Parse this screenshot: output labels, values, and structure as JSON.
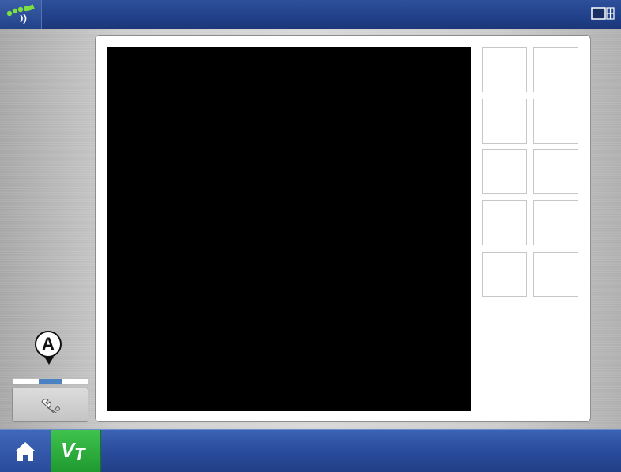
{
  "topbar": {
    "gps_icon": "gps-signal-icon",
    "screen_icon": "screen-toggle-icon"
  },
  "panel": {
    "display": "virtual-terminal-display",
    "soft_keys": [
      {
        "row": 1,
        "col": 1
      },
      {
        "row": 1,
        "col": 2
      },
      {
        "row": 2,
        "col": 1
      },
      {
        "row": 2,
        "col": 2
      },
      {
        "row": 3,
        "col": 1
      },
      {
        "row": 3,
        "col": 2
      },
      {
        "row": 4,
        "col": 1
      },
      {
        "row": 4,
        "col": 2
      },
      {
        "row": 5,
        "col": 1
      },
      {
        "row": 5,
        "col": 2
      }
    ]
  },
  "callout": {
    "label": "A"
  },
  "page_indicator": {
    "pages": 3,
    "active": 2
  },
  "tool_button": {
    "icon": "wrench-icon"
  },
  "bottombar": {
    "home_icon": "home-icon",
    "vt_label_v": "V",
    "vt_label_t": "T"
  },
  "colors": {
    "bar_blue": "#2a4c9c",
    "vt_green": "#1f9a2f",
    "indicator_blue": "#4b82c3"
  }
}
